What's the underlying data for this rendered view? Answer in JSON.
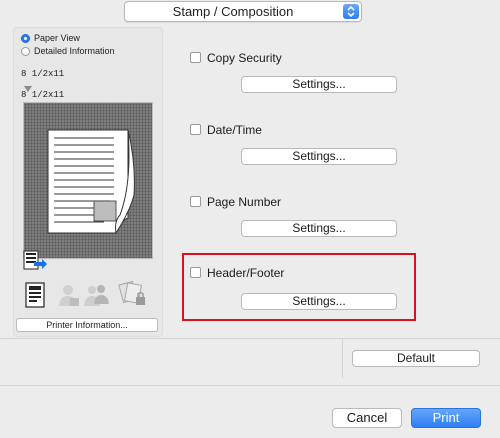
{
  "header": {
    "section_select": "Stamp / Composition"
  },
  "left_panel": {
    "view_options": [
      {
        "label": "Paper View",
        "selected": true
      },
      {
        "label": "Detailed Information",
        "selected": false
      }
    ],
    "original_size": "8 1/2x11",
    "output_size": "8 1/2x11",
    "printer_info_button": "Printer Information...",
    "icons": [
      "printer-output-icon",
      "document-icon",
      "user-auth-icon",
      "account-track-icon",
      "secure-print-icon"
    ]
  },
  "options": {
    "copy_security": {
      "label": "Copy Security",
      "checked": false,
      "settings_label": "Settings..."
    },
    "date_time": {
      "label": "Date/Time",
      "checked": false,
      "settings_label": "Settings..."
    },
    "page_number": {
      "label": "Page Number",
      "checked": false,
      "settings_label": "Settings..."
    },
    "header_footer": {
      "label": "Header/Footer",
      "checked": false,
      "settings_label": "Settings..."
    }
  },
  "footer": {
    "default_label": "Default",
    "cancel_label": "Cancel",
    "print_label": "Print"
  },
  "colors": {
    "accent": "#2d7cf0",
    "highlight": "#e0101a"
  }
}
